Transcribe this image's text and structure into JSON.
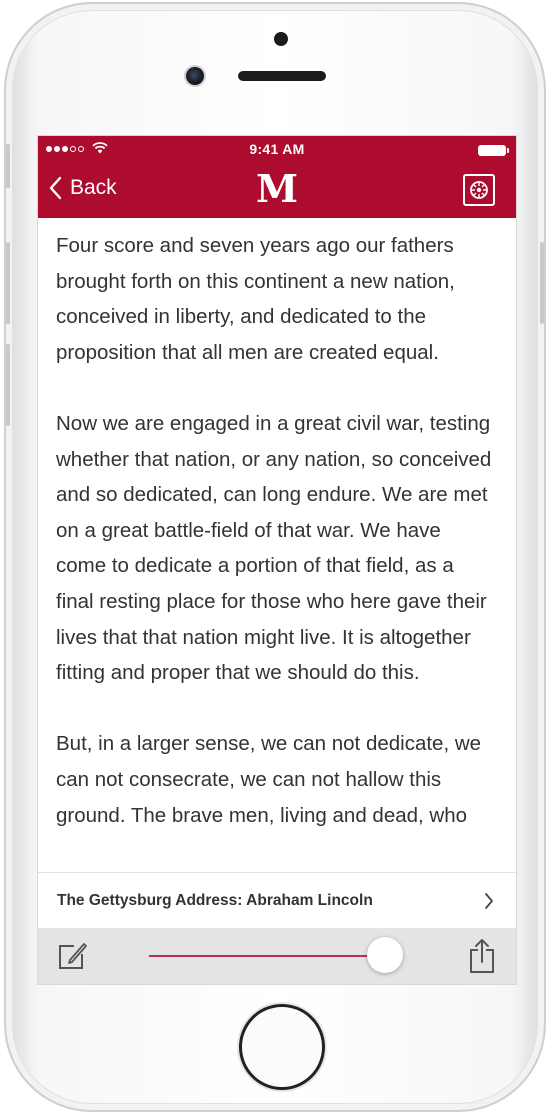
{
  "status_bar": {
    "time": "9:41 AM"
  },
  "nav": {
    "back_label": "Back",
    "logo": "M",
    "accent_color": "#ad0c2f"
  },
  "content": {
    "paragraphs": [
      "Four score and seven years ago our fathers brought forth on this continent a new nation, conceived in liberty, and dedicated to the proposition that all men are created equal.",
      "Now we are engaged in a great civil war, testing whether that nation, or any nation, so conceived and so dedicated, can long endure. We are met on a great battle-field of that war. We have come to dedicate a portion of that field, as a final resting place for those who here gave their lives that that nation might live. It is altogether fitting and proper that we should do this.",
      "But, in a larger sense, we can not dedicate, we can not consecrate, we can not hallow this ground. The brave men, living and dead, who"
    ]
  },
  "chapter": {
    "title": "The Gettysburg Address: Abraham Lincoln"
  },
  "toolbar": {
    "slider_value": 1.0
  },
  "icons": {
    "back": "chevron-left-icon",
    "settings": "reader-settings-icon",
    "chapter": "chevron-right-icon",
    "note": "edit-note-icon",
    "share": "share-icon"
  }
}
